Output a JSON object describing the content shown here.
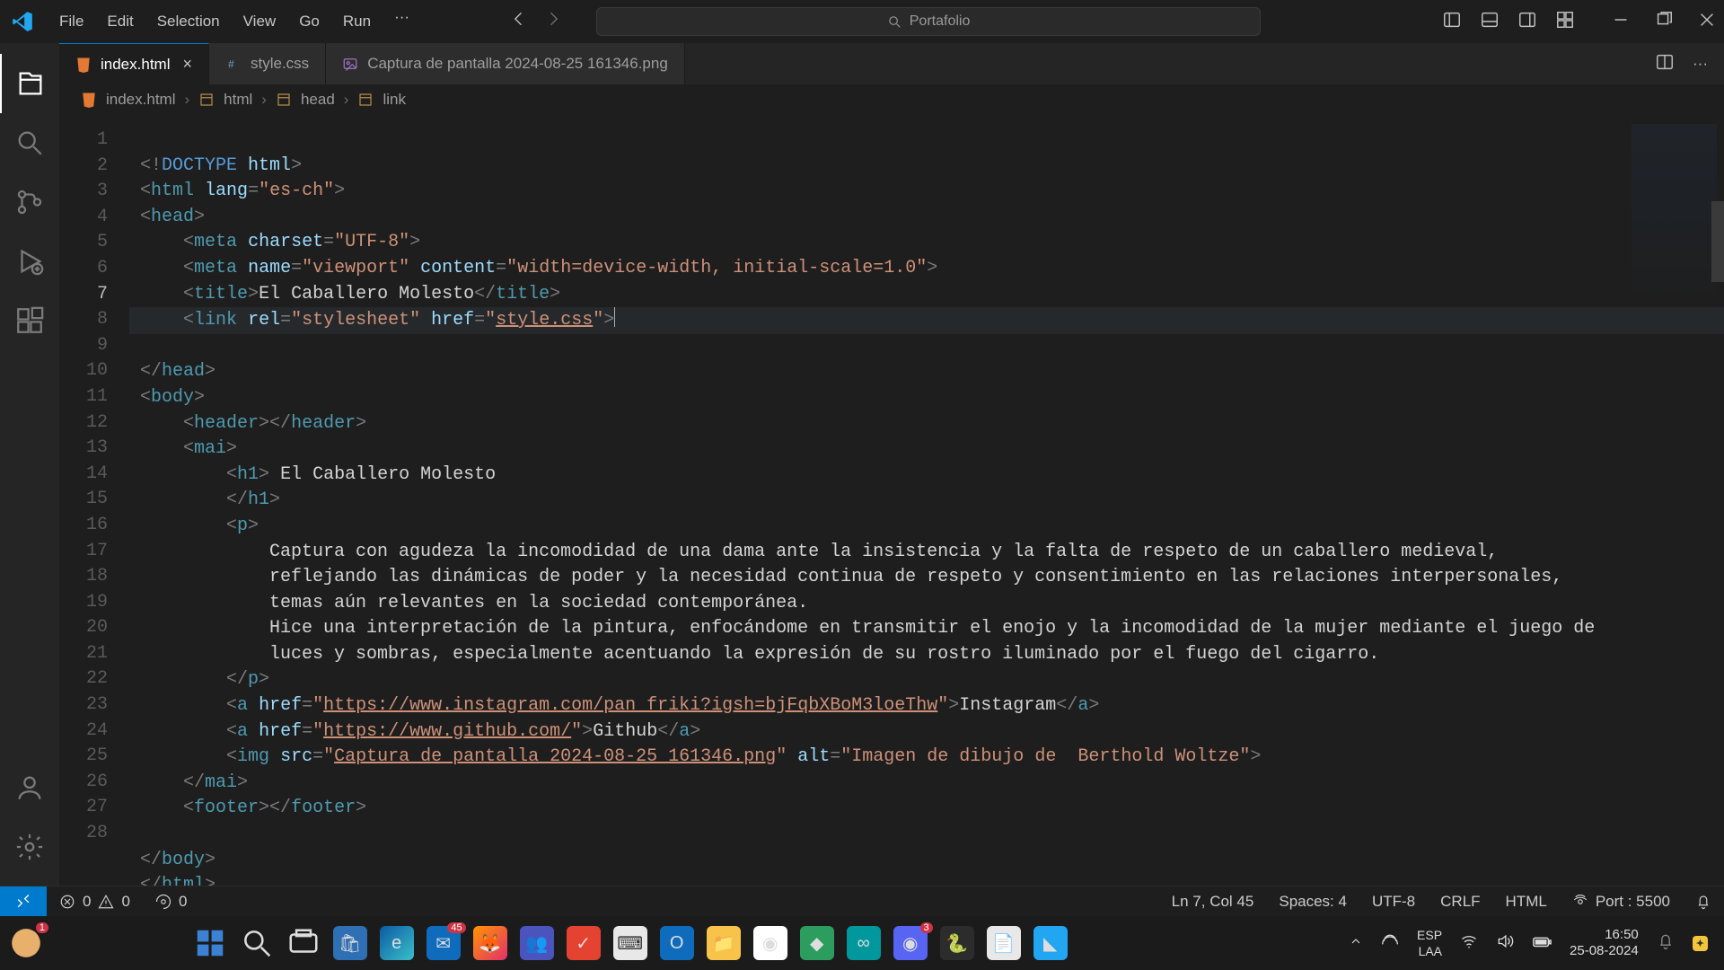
{
  "menu": {
    "file": "File",
    "edit": "Edit",
    "selection": "Selection",
    "view": "View",
    "go": "Go",
    "run": "Run"
  },
  "search_placeholder": "Portafolio",
  "tabs": [
    {
      "label": "index.html",
      "icon": "html",
      "active": true,
      "dirty": false
    },
    {
      "label": "style.css",
      "icon": "css",
      "active": false,
      "dirty": false
    },
    {
      "label": "Captura de pantalla 2024-08-25 161346.png",
      "icon": "image",
      "active": false,
      "dirty": false
    }
  ],
  "breadcrumb": {
    "file": "index.html",
    "path": [
      "html",
      "head",
      "link"
    ]
  },
  "status": {
    "errors": "0",
    "warnings": "0",
    "ports": "0",
    "cursor": "Ln 7, Col 45",
    "spaces": "Spaces: 4",
    "encoding": "UTF-8",
    "eol": "CRLF",
    "lang": "HTML",
    "live": "Port : 5500"
  },
  "code": {
    "doc_title": "El Caballero Molesto",
    "stylesheet": "style.css",
    "paragraph_l1": "Captura con agudeza la incomodidad de una dama ante la insistencia y la falta de respeto de un caballero medieval,",
    "paragraph_l2": "reflejando las dinámicas de poder y la necesidad continua de respeto y consentimiento en las relaciones interpersonales,",
    "paragraph_l3": "temas aún relevantes en la sociedad contemporánea.",
    "paragraph_l4": "Hice una interpretación de la pintura, enfocándome en transmitir el enojo y la incomodidad de la mujer mediante el juego de",
    "paragraph_l5": "luces y sombras, especialmente acentuando la expresión de su rostro iluminado por el fuego del cigarro.",
    "link_ig": "https://www.instagram.com/pan_friki?igsh=bjFqbXBoM3loeThw",
    "link_ig_text": "Instagram",
    "link_gh": "https://www.github.com/",
    "link_gh_text": "Github",
    "img_src": "Captura de pantalla 2024-08-25 161346.png",
    "img_alt": "Imagen de dibujo de  Berthold Woltze",
    "lang_attr": "es-ch",
    "charset": "UTF-8",
    "viewport": "width=device-width, initial-scale=1.0"
  },
  "taskbar": {
    "lang": "ESP",
    "kb": "LAA",
    "time": "16:50",
    "date": "25-08-2024",
    "mail_badge": "45",
    "discord_badge": "3",
    "copilot_badge": "1"
  }
}
